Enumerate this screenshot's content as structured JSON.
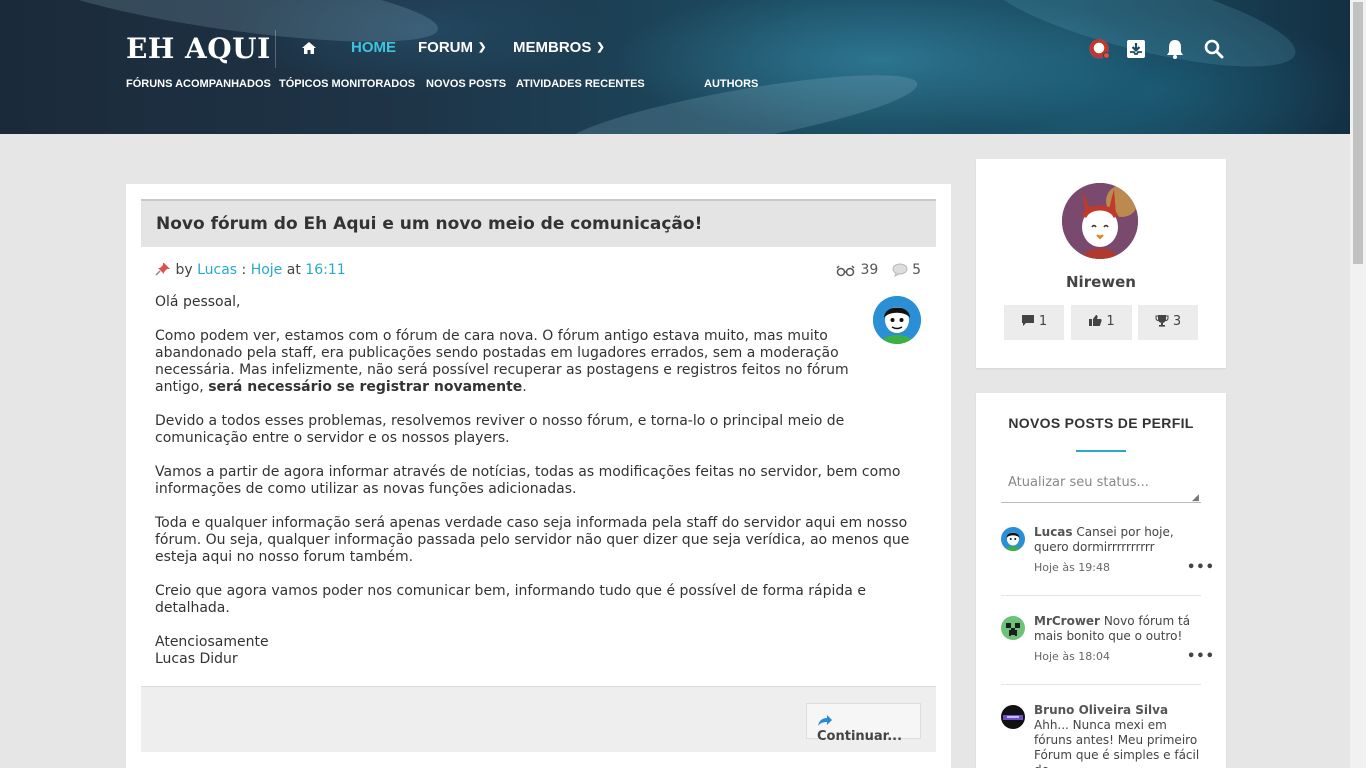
{
  "header": {
    "logo": "EH AQUI",
    "nav": [
      {
        "label": "HOME",
        "active": true
      },
      {
        "label": "FORUM"
      },
      {
        "label": "MEMBROS"
      }
    ],
    "subnav": [
      "FÓRUNS ACOMPANHADOS",
      "TÓPICOS MONITORADOS",
      "NOVOS POSTS",
      "ATIVIDADES RECENTES",
      "AUTHORS"
    ],
    "icons": [
      "home-icon",
      "user-avatar",
      "inbox-icon",
      "bell-icon",
      "search-icon"
    ],
    "accent_color": "#3ec5dd"
  },
  "post": {
    "title": "Novo fórum do Eh Aqui e um novo meio de comunicação!",
    "by": "by",
    "author": "Lucas",
    "sep": ":",
    "date": "Hoje",
    "at": "at",
    "time": "16:11",
    "views": "39",
    "comments": "5",
    "greeting": "Olá pessoal,",
    "p1_start": "Como podem ver, estamos com o fórum de cara nova. O fórum antigo estava muito, mas muito abandonado pela staff, era publicações sendo postadas em lugadores errados, sem a moderação necessária. Mas infelizmente, não será possível recuperar as postagens e registros feitos no fórum antigo, ",
    "p1_bold": "será necessário se registrar novamente",
    "p1_end": ".",
    "p2": "Devido a todos esses problemas, resolvemos reviver o nosso fórum, e torna-lo o principal meio de comunicação entre o servidor e os nossos players.",
    "p3": "Vamos a partir de agora informar através de notícias, todas as modificações feitas no servidor, bem como informações de como utilizar as novas funções adicionadas.",
    "p4": "Toda e qualquer informação será apenas verdade caso seja informada pela staff do servidor aqui em nosso fórum. Ou seja, qualquer informação passada pelo servidor não quer dizer que seja verídica, ao menos que esteja aqui no nosso forum também.",
    "p5": "Creio que agora vamos poder nos comunicar bem, informando tudo que é possível de forma rápida e detalhada.",
    "sign1": "Atenciosamente",
    "sign2": "Lucas Didur",
    "continue_label": "Continuar..."
  },
  "profile": {
    "name": "Nirewen",
    "messages": "1",
    "likes": "1",
    "trophies": "3"
  },
  "feed": {
    "title": "NOVOS POSTS DE PERFIL",
    "placeholder": "Atualizar seu status...",
    "items": [
      {
        "user": "Lucas",
        "text": "Cansei por hoje, quero dormirrrrrrrrrr",
        "time": "Hoje às 19:48"
      },
      {
        "user": "MrCrower",
        "text": "Novo fórum tá mais bonito que o outro!",
        "time": "Hoje às 18:04"
      },
      {
        "user": "Bruno Oliveira Silva",
        "text": "Ahh... Nunca mexi em fóruns antes! Meu primeiro Fórum que é simples e fácil de",
        "time": ""
      }
    ],
    "more_label": "•••"
  }
}
